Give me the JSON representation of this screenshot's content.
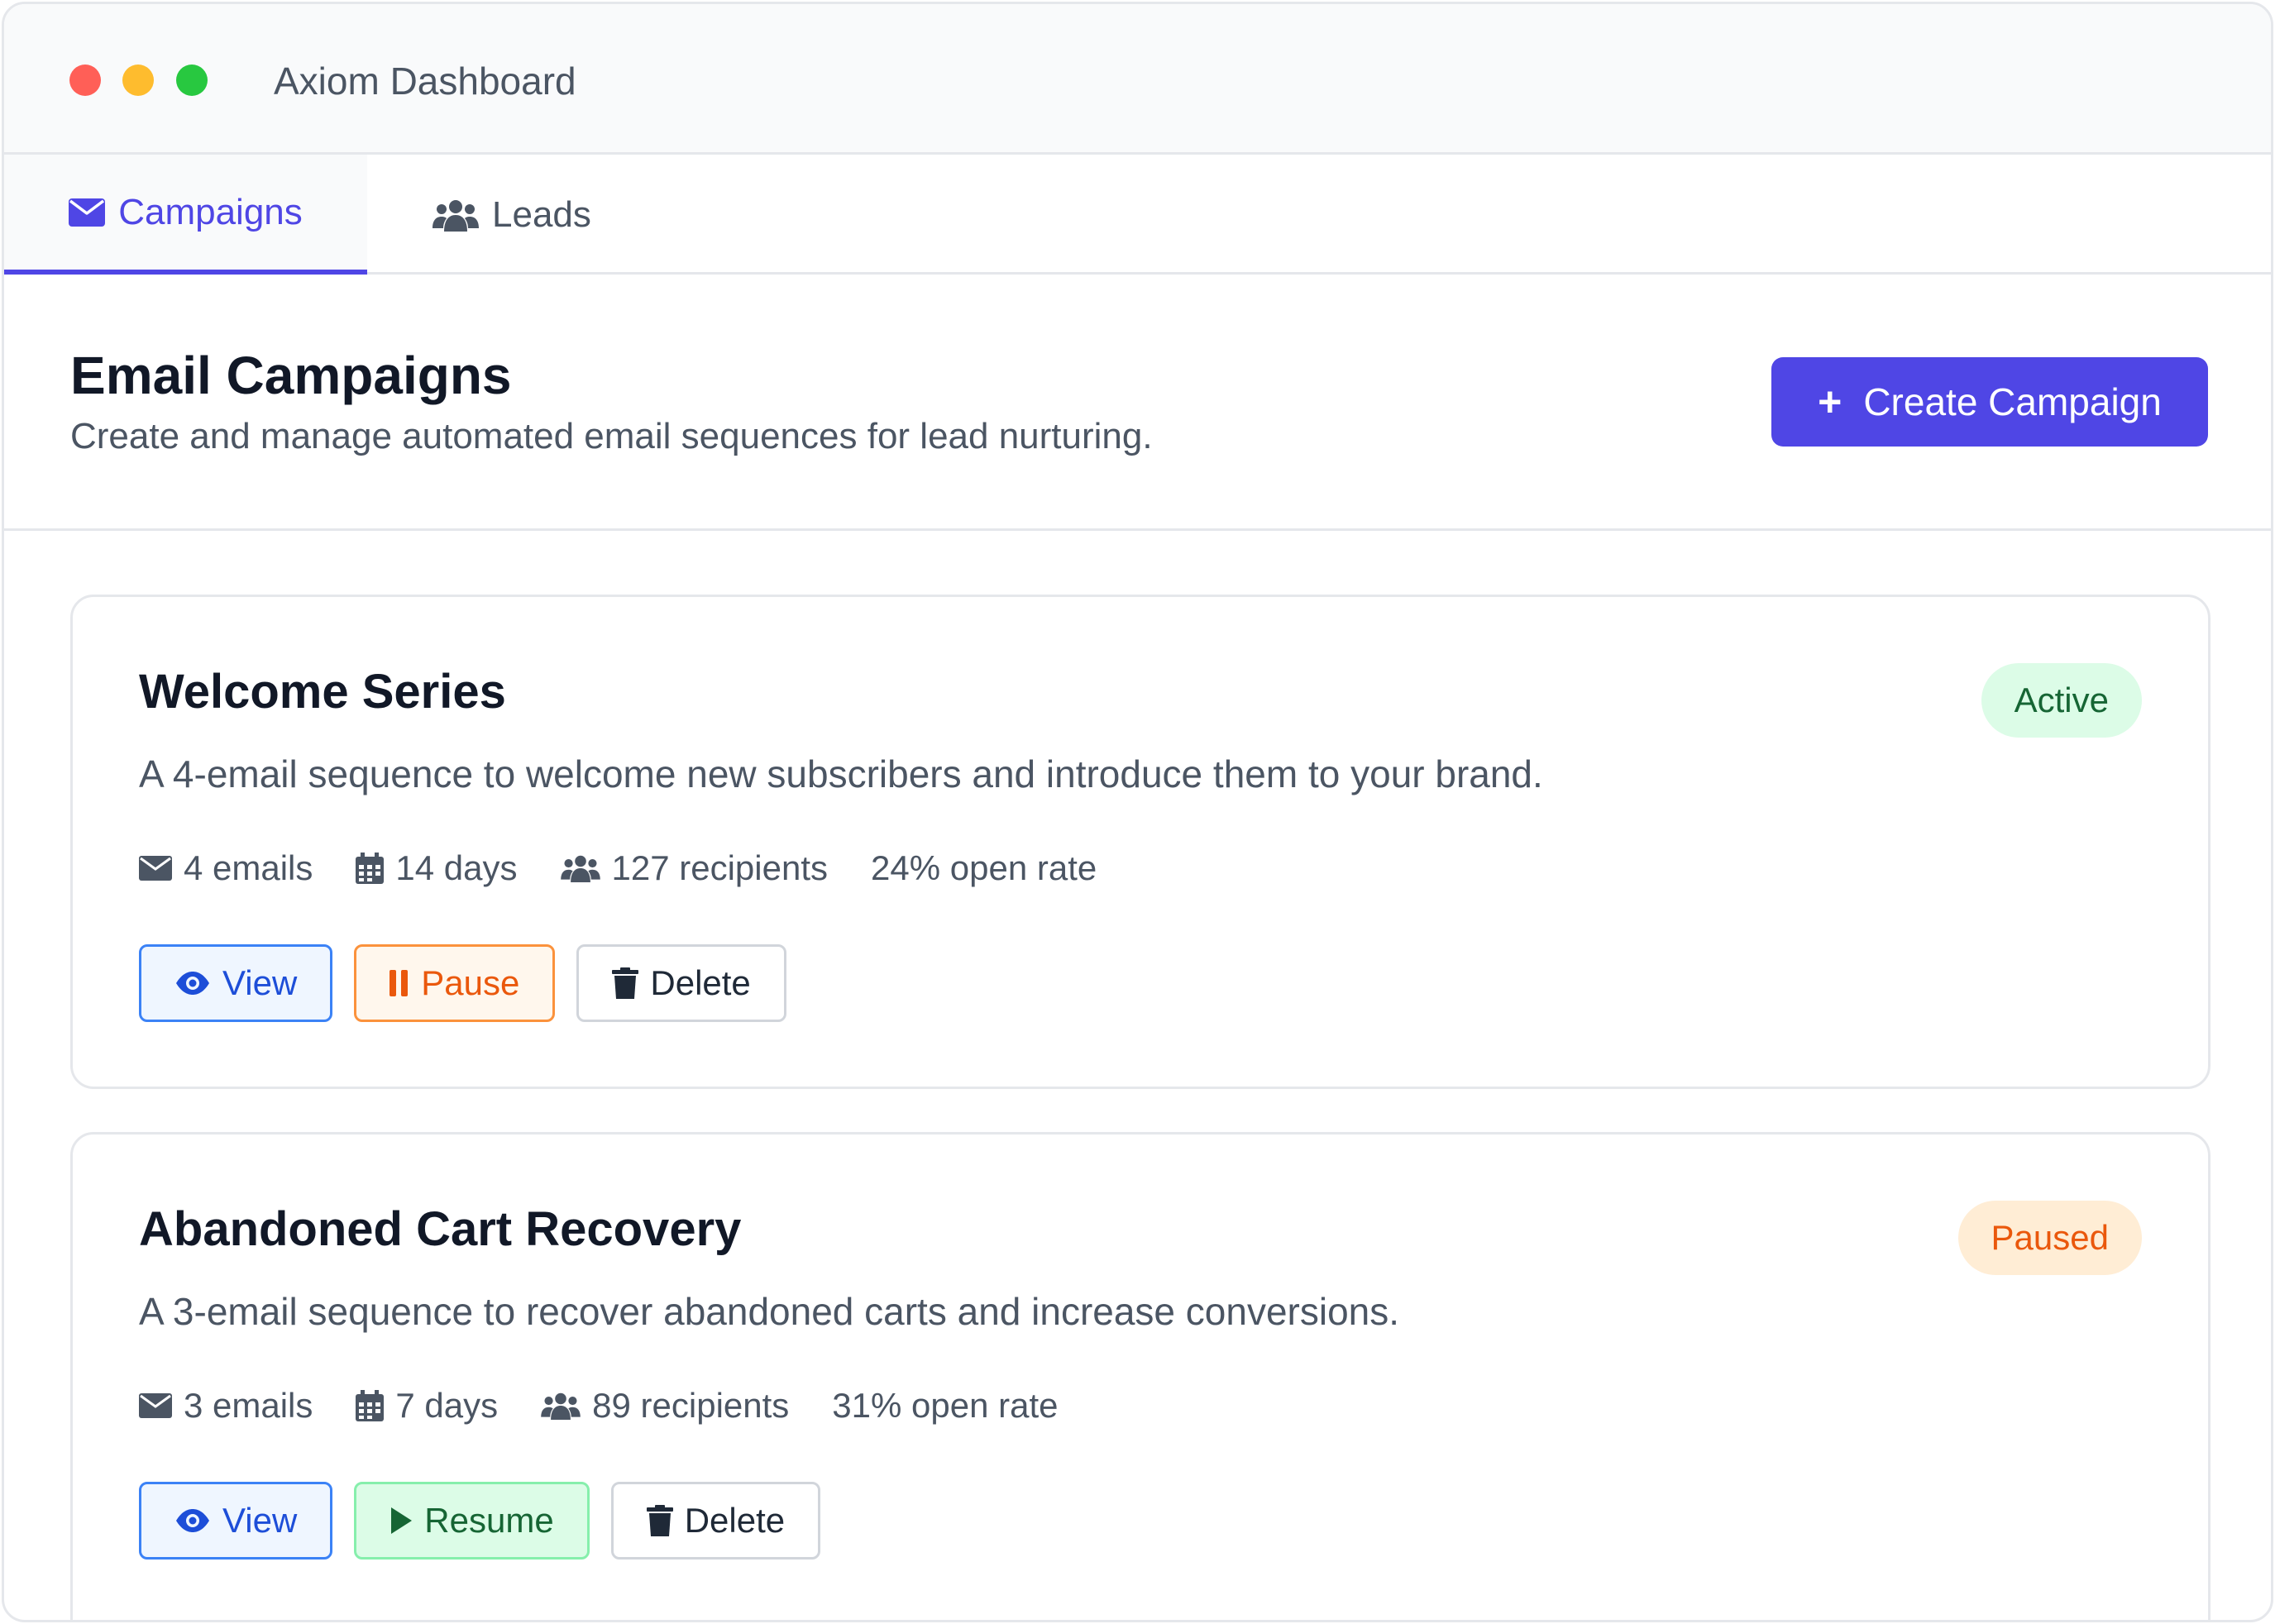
{
  "window": {
    "title": "Axiom Dashboard",
    "traffic_lights": {
      "close": "#ff5f57",
      "minimize": "#febc2e",
      "zoom": "#28c840"
    }
  },
  "colors": {
    "accent": "#4f46e5"
  },
  "tabs": [
    {
      "label": "Campaigns",
      "icon": "envelope-icon",
      "active": true
    },
    {
      "label": "Leads",
      "icon": "users-icon",
      "active": false
    }
  ],
  "header": {
    "title": "Email Campaigns",
    "subtitle": "Create and manage automated email sequences for lead nurturing.",
    "create_button": {
      "icon": "+",
      "label": "Create Campaign"
    }
  },
  "campaigns": [
    {
      "name": "Welcome Series",
      "description": "A 4-email sequence to welcome new subscribers and introduce them to your brand.",
      "status": "Active",
      "emails": "4 emails",
      "duration": "14 days",
      "recipients": "127 recipients",
      "open_rate": "24% open rate",
      "actions": {
        "view": "View",
        "toggle": "Pause",
        "delete": "Delete"
      }
    },
    {
      "name": "Abandoned Cart Recovery",
      "description": "A 3-email sequence to recover abandoned carts and increase conversions.",
      "status": "Paused",
      "emails": "3 emails",
      "duration": "7 days",
      "recipients": "89 recipients",
      "open_rate": "31% open rate",
      "actions": {
        "view": "View",
        "toggle": "Resume",
        "delete": "Delete"
      }
    }
  ]
}
